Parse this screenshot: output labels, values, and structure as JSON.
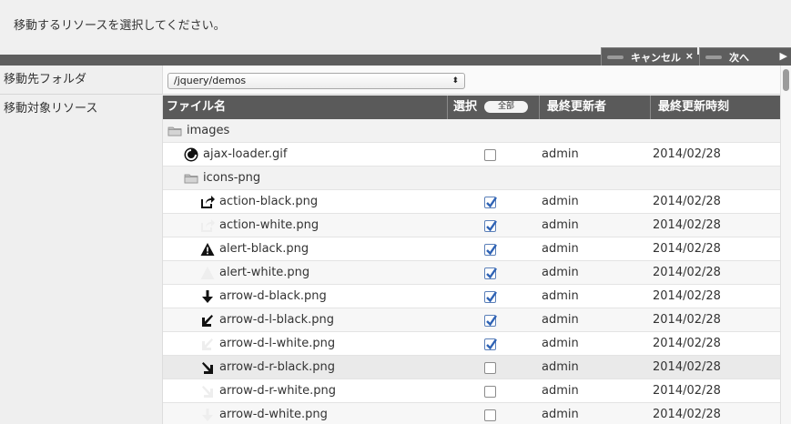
{
  "instruction": "移動するリソースを選択してください。",
  "toolbar": {
    "cancel_label": "キャンセル",
    "cancel_glyph": "×",
    "next_label": "次へ",
    "next_glyph": "▶"
  },
  "form": {
    "folder_label": "移動先フォルダ",
    "folder_value": "/jquery/demos",
    "target_label": "移動対象リソース"
  },
  "table": {
    "columns": {
      "name": "ファイル名",
      "select": "選択",
      "select_all": "全部",
      "updater": "最終更新者",
      "updated": "最終更新時刻"
    },
    "rows": [
      {
        "name": "images",
        "type": "folder",
        "icon": "folder-icon"
      },
      {
        "name": "ajax-loader.gif",
        "type": "file",
        "icon": "loader-icon",
        "checked": false,
        "updater": "admin",
        "updated": "2014/02/28"
      },
      {
        "name": "icons-png",
        "type": "folder",
        "icon": "folder-icon"
      },
      {
        "name": "action-black.png",
        "type": "file",
        "icon": "action-icon",
        "checked": true,
        "updater": "admin",
        "updated": "2014/02/28"
      },
      {
        "name": "action-white.png",
        "type": "file",
        "icon": "action-white-icon",
        "checked": true,
        "updater": "admin",
        "updated": "2014/02/28"
      },
      {
        "name": "alert-black.png",
        "type": "file",
        "icon": "alert-icon",
        "checked": true,
        "updater": "admin",
        "updated": "2014/02/28"
      },
      {
        "name": "alert-white.png",
        "type": "file",
        "icon": "alert-white-icon",
        "checked": true,
        "updater": "admin",
        "updated": "2014/02/28"
      },
      {
        "name": "arrow-d-black.png",
        "type": "file",
        "icon": "arrow-down-icon",
        "checked": true,
        "updater": "admin",
        "updated": "2014/02/28"
      },
      {
        "name": "arrow-d-l-black.png",
        "type": "file",
        "icon": "arrow-down-left-icon",
        "checked": true,
        "updater": "admin",
        "updated": "2014/02/28"
      },
      {
        "name": "arrow-d-l-white.png",
        "type": "file",
        "icon": "arrow-down-left-white-icon",
        "checked": true,
        "updater": "admin",
        "updated": "2014/02/28"
      },
      {
        "name": "arrow-d-r-black.png",
        "type": "file",
        "icon": "arrow-down-right-icon",
        "checked": false,
        "updater": "admin",
        "updated": "2014/02/28"
      },
      {
        "name": "arrow-d-r-white.png",
        "type": "file",
        "icon": "arrow-down-right-white-icon",
        "checked": false,
        "updater": "admin",
        "updated": "2014/02/28"
      },
      {
        "name": "arrow-d-white.png",
        "type": "file",
        "icon": "arrow-down-white-icon",
        "checked": false,
        "updater": "admin",
        "updated": "2014/02/28"
      }
    ]
  }
}
